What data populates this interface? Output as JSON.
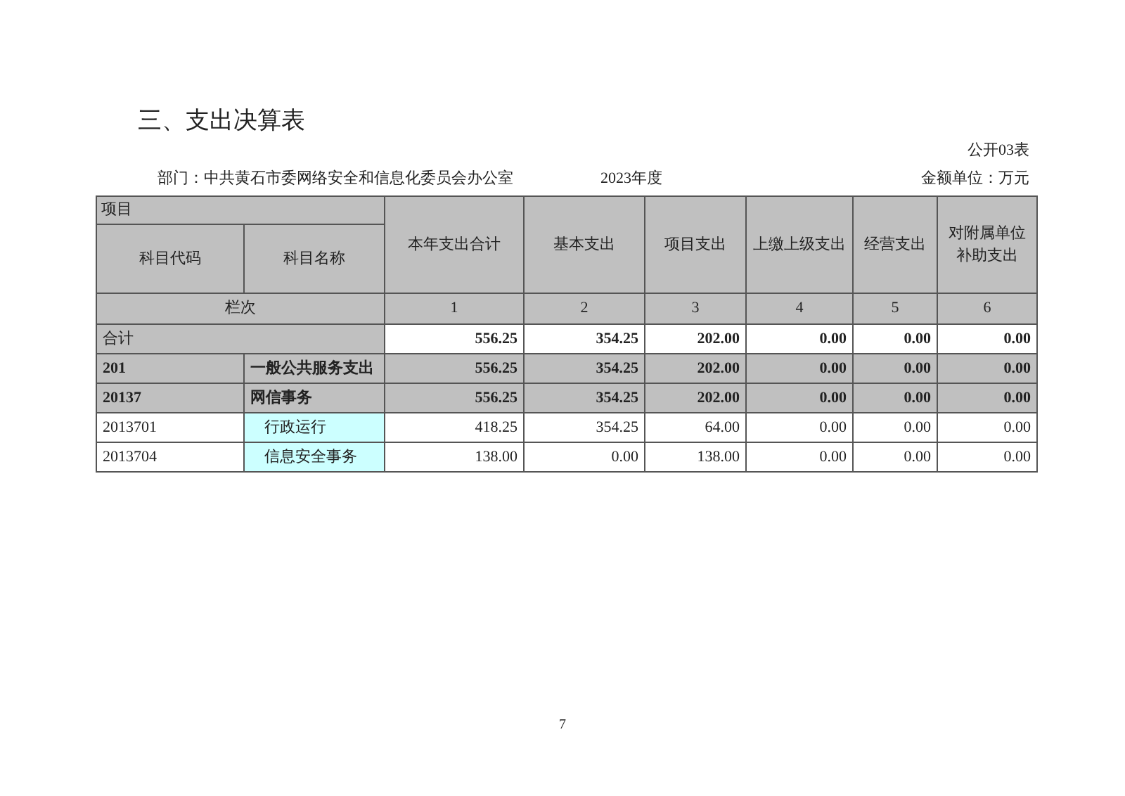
{
  "title": "三、支出决算表",
  "form_number": "公开03表",
  "department": "部门：中共黄石市委网络安全和信息化委员会办公室",
  "year": "2023年度",
  "unit": "金额单位：万元",
  "table": {
    "group_header": "项目",
    "sub_headers": [
      "科目代码",
      "科目名称"
    ],
    "columns": [
      "本年支出合计",
      "基本支出",
      "项目支出",
      "上缴上级支出",
      "经营支出",
      "对附属单位补助支出"
    ],
    "index_label": "栏次",
    "index_numbers": [
      "1",
      "2",
      "3",
      "4",
      "5",
      "6"
    ],
    "rows": [
      {
        "kind": "total",
        "code": "合计",
        "values": [
          "556.25",
          "354.25",
          "202.00",
          "0.00",
          "0.00",
          "0.00"
        ]
      },
      {
        "kind": "class",
        "code": "201",
        "name": "一般公共服务支出",
        "values": [
          "556.25",
          "354.25",
          "202.00",
          "0.00",
          "0.00",
          "0.00"
        ]
      },
      {
        "kind": "class",
        "code": "20137",
        "name": "网信事务",
        "values": [
          "556.25",
          "354.25",
          "202.00",
          "0.00",
          "0.00",
          "0.00"
        ]
      },
      {
        "kind": "item",
        "code": "2013701",
        "name": "行政运行",
        "values": [
          "418.25",
          "354.25",
          "64.00",
          "0.00",
          "0.00",
          "0.00"
        ]
      },
      {
        "kind": "item",
        "code": "2013704",
        "name": "信息安全事务",
        "values": [
          "138.00",
          "0.00",
          "138.00",
          "0.00",
          "0.00",
          "0.00"
        ]
      }
    ]
  },
  "page_number": "7"
}
